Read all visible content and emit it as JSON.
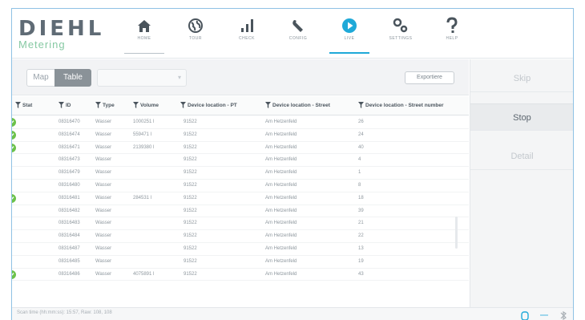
{
  "brand": {
    "name": "DIEHL",
    "sub": "Metering"
  },
  "nav": [
    {
      "label": "HOME",
      "icon": "home-icon"
    },
    {
      "label": "TOUR",
      "icon": "globe-icon"
    },
    {
      "label": "CHECK",
      "icon": "bar-chart-icon"
    },
    {
      "label": "CONFIG",
      "icon": "wrench-icon"
    },
    {
      "label": "LIVE",
      "icon": "play-icon"
    },
    {
      "label": "SETTINGS",
      "icon": "settings-icon"
    },
    {
      "label": "HELP",
      "icon": "question-icon"
    }
  ],
  "toolbar": {
    "map_label": "Map",
    "table_label": "Table",
    "dropdown_value": "",
    "export_label": "Exportiere"
  },
  "table": {
    "columns": [
      "Stat",
      "ID",
      "Type",
      "Volume",
      "Device location - PT",
      "Device location - Street",
      "Device location - Street number"
    ],
    "rows": [
      {
        "ok": true,
        "id": "08316470",
        "type": "Wasser",
        "volume": "1000251 l",
        "pt": "91522",
        "street": "Am Hetzenfeld",
        "num": "26"
      },
      {
        "ok": true,
        "id": "08316474",
        "type": "Wasser",
        "volume": "559471 l",
        "pt": "91522",
        "street": "Am Hetzenfeld",
        "num": "24"
      },
      {
        "ok": true,
        "id": "08316471",
        "type": "Wasser",
        "volume": "2139380 l",
        "pt": "91522",
        "street": "Am Hetzenfeld",
        "num": "40"
      },
      {
        "ok": false,
        "id": "08316473",
        "type": "Wasser",
        "volume": "",
        "pt": "91522",
        "street": "Am Hetzenfeld",
        "num": "4"
      },
      {
        "ok": false,
        "id": "08316479",
        "type": "Wasser",
        "volume": "",
        "pt": "91522",
        "street": "Am Hetzenfeld",
        "num": "1"
      },
      {
        "ok": false,
        "id": "08316480",
        "type": "Wasser",
        "volume": "",
        "pt": "91522",
        "street": "Am Hetzenfeld",
        "num": "8"
      },
      {
        "ok": true,
        "id": "08316481",
        "type": "Wasser",
        "volume": "284531 l",
        "pt": "91522",
        "street": "Am Hetzenfeld",
        "num": "18"
      },
      {
        "ok": false,
        "id": "08316482",
        "type": "Wasser",
        "volume": "",
        "pt": "91522",
        "street": "Am Hetzenfeld",
        "num": "39"
      },
      {
        "ok": false,
        "id": "08316483",
        "type": "Wasser",
        "volume": "",
        "pt": "91522",
        "street": "Am Hetzenfeld",
        "num": "21"
      },
      {
        "ok": false,
        "id": "08316484",
        "type": "Wasser",
        "volume": "",
        "pt": "91522",
        "street": "Am Hetzenfeld",
        "num": "22"
      },
      {
        "ok": false,
        "id": "08316487",
        "type": "Wasser",
        "volume": "",
        "pt": "91522",
        "street": "Am Hetzenfeld",
        "num": "13"
      },
      {
        "ok": false,
        "id": "08316485",
        "type": "Wasser",
        "volume": "",
        "pt": "91522",
        "street": "Am Hetzenfeld",
        "num": "19"
      },
      {
        "ok": true,
        "id": "08316486",
        "type": "Wasser",
        "volume": "4075891 l",
        "pt": "91522",
        "street": "Am Hetzenfeld",
        "num": "43"
      }
    ]
  },
  "side": {
    "skip_label": "Skip",
    "stop_label": "Stop",
    "detail_label": "Detail"
  },
  "footer": {
    "text": "Scan time (hh:mm:ss): 15:57, Raw: 108, 108"
  },
  "colors": {
    "accent": "#1fa9d8",
    "ok": "#6cc24a",
    "brand_gray": "#5f6b75",
    "brand_green": "#86c9a3"
  }
}
